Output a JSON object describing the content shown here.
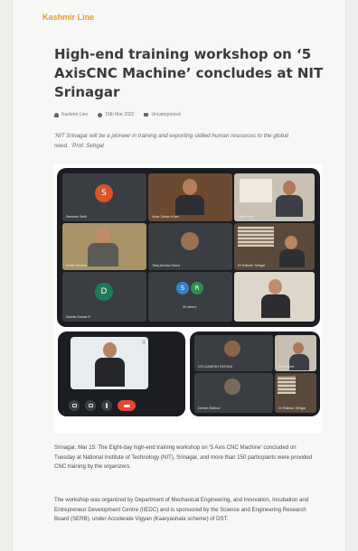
{
  "site": {
    "name": "Kashmir Line"
  },
  "article": {
    "title": "High-end training workshop on ‘5 AxisCNC Machine’ concludes at NIT Srinagar",
    "meta": {
      "author": "Kashmir Line",
      "date": "15th Mar 2022",
      "category": "Uncategorized"
    },
    "quote": "‘NIT Srinagar will be a pioneer in training and exporting skilled human resources to the global need.",
    "quote_author": "’Prof. Sehgal",
    "paragraph_1": "Srinagar, Mar 15: The Eight-day high-end training workshop on ‘5 Axis CNC Machine’ concluded on Tuesday at National Institute of Technology (NIT), Srinagar, and more than 150 participants were provided CNC training by the organizers.",
    "paragraph_2": "The workshop was organized by Department of Mechanical Engineering, and Innovation, Incubation and Entrepreneur Development Centre (IIEDC) and is sponsored by the Science and Engineering Research Board (SERB), under Accelerate Vigyan (Kaaryashala scheme) of DST."
  },
  "meeting": {
    "grid": [
      {
        "name": "Saransh Sahil",
        "initial": "S",
        "color": "#d9532b"
      },
      {
        "name": "Nosir Zahan Khan"
      },
      {
        "name": "Saad Peer"
      },
      {
        "name": "Khalid Ahmad"
      },
      {
        "name": "Tariq Ahmad Jhara"
      },
      {
        "name": "Dr Rakesh Sehgal"
      },
      {
        "name": "Dinesh Kumar R",
        "initial": "D",
        "color": "#1f7a5a"
      },
      {
        "name": "29 others",
        "initials": [
          "S",
          "R"
        ],
        "colors": [
          "#3b82c4",
          "#2f8f4e"
        ]
      }
    ],
    "second_call": [
      {
        "name": "OTI-GANESH PATHAK"
      },
      {
        "name": "Saad Peer"
      },
      {
        "name": "Dinesh Rathod"
      },
      {
        "name": "Dr Rakesh Sehgal"
      }
    ]
  }
}
